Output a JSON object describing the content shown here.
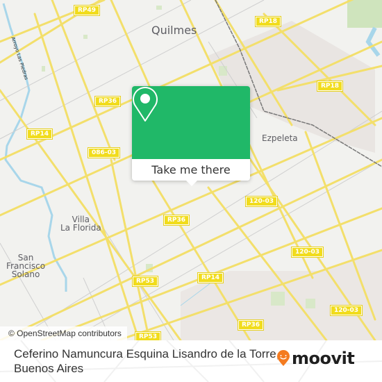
{
  "map": {
    "place_labels": [
      {
        "id": "quilmes",
        "text": "Quilmes"
      },
      {
        "id": "ezpeleta",
        "text": "Ezpeleta"
      },
      {
        "id": "villa-la-florida",
        "text": "Villa\nLa Florida"
      },
      {
        "id": "san-francisco-solano",
        "text": "San\nFrancisco\nSolano"
      }
    ],
    "stream_label": "Arroyo Las Piedras",
    "road_shields": [
      {
        "id": "rp49",
        "text": "RP49"
      },
      {
        "id": "rp18-north",
        "text": "RP18"
      },
      {
        "id": "rp18-east",
        "text": "RP18"
      },
      {
        "id": "rp36-west",
        "text": "RP36"
      },
      {
        "id": "rp14-west",
        "text": "RP14"
      },
      {
        "id": "086-03",
        "text": "086-03"
      },
      {
        "id": "rp36-center",
        "text": "RP36"
      },
      {
        "id": "120-03-a",
        "text": "120-03"
      },
      {
        "id": "120-03-b",
        "text": "120-03"
      },
      {
        "id": "120-03-c",
        "text": "120-03"
      },
      {
        "id": "rp53",
        "text": "RP53"
      },
      {
        "id": "rp14-south",
        "text": "RP14"
      },
      {
        "id": "rp36-south",
        "text": "RP36"
      },
      {
        "id": "rp53-south",
        "text": "RP53"
      }
    ],
    "attribution": "© OpenStreetMap contributors"
  },
  "popup": {
    "icon": "map-pin-icon",
    "button_label": "Take me there",
    "accent_color": "#20b868"
  },
  "footer": {
    "address_line1": "Ceferino Namuncura Esquina Lisandro de la Torre,",
    "address_line2": "Buenos Aires",
    "brand": "moovit",
    "brand_color": "#f47b20"
  }
}
